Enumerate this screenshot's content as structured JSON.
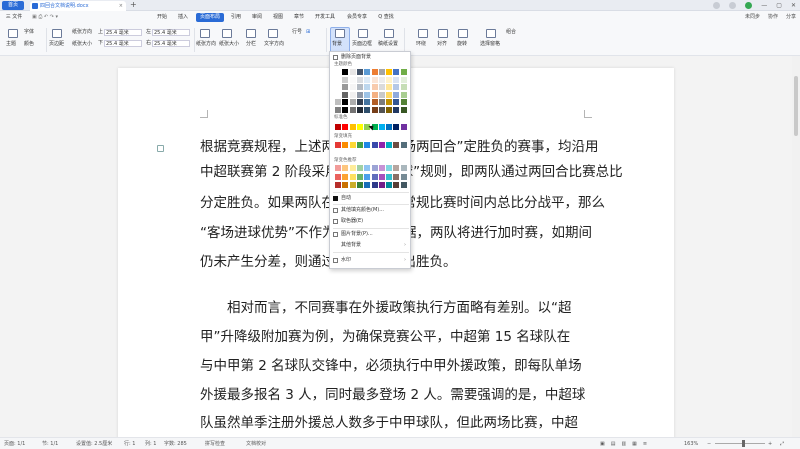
{
  "titlebar": {
    "home_tab": "首页",
    "doc_tab": "四回合文档说明.docx",
    "close": "×",
    "new_tab": "+"
  },
  "menu": {
    "file": "三 文件",
    "items": [
      "开始",
      "插入",
      "页面布局",
      "引用",
      "审阅",
      "视图",
      "章节",
      "开发工具",
      "会员专享"
    ],
    "active_index": 2,
    "search": "Q 查找",
    "right_items": [
      "未同步",
      "协作",
      "分享"
    ]
  },
  "ribbon": {
    "theme": "主题",
    "font_label": "字体",
    "color_label": "颜色",
    "margin": "页边距",
    "size": "纸张方向",
    "margin_top": "上",
    "margin_top_value": "25.4 毫米",
    "margin_bottom": "下",
    "margin_bottom_value": "25.4 毫米",
    "margin_left": "左",
    "margin_left_value": "25.4 毫米",
    "margin_right": "右",
    "margin_right_value": "25.4 毫米",
    "orientation": "纸张方向",
    "paper_size": "纸张大小",
    "columns": "分栏",
    "text_dir": "文字方向",
    "line_num": "行号",
    "page_bg": "背景",
    "page_border": "页面边框",
    "page_setup": "稿纸设置",
    "wrap": "环绕",
    "align": "对齐",
    "rotate": "旋转",
    "select_pane": "选择窗格",
    "group": "组合"
  },
  "document": {
    "lines": [
      "根据竞赛规程，上述两阶段以主客场两回合”定胜负的赛事，均沿用",
      "中超联赛第 2 阶段采用的”客场进球”规则，即两队通过两回合比赛总比",
      "分定胜负。如果两队在两回合比赛常规比赛时间内总比分战平，那么",
      "“客场进球优势”不作为胜负判定依据，两队将进行加时赛，如期间",
      "仍未产生分差，则通过点球大战决出胜负。",
      "相对而言，不同赛事在外援政策执行方面略有差别。以“超",
      "甲”升降级附加赛为例，为确保竞赛公平，中超第 15 名球队在",
      "与中甲第 2 名球队交锋中，必须执行中甲外援政策，即每队单场",
      "外援最多报名 3 人，同时最多登场 2 人。需要强调的是，中超球",
      "队虽然单季注册外援总人数多于中甲球队，但此两场比赛，中超"
    ]
  },
  "dropdown": {
    "delete_bg": "删除页面背景",
    "theme_colors": "主题颜色",
    "standard_colors": "标准色",
    "gradient_fill": "渐变填充",
    "gradient_style": "渐变色推荐",
    "auto": "自动",
    "other_fill": "其他填充颜色(M)...",
    "eyedropper": "取色器(E)",
    "image_bg": "图片背景(P)...",
    "other_bg": "其他背景",
    "watermark": "水印"
  },
  "palette": {
    "theme_top": [
      "#ffffff",
      "#000000",
      "#e7e6e6",
      "#44546a",
      "#5b9bd5",
      "#ed7d31",
      "#a5a5a5",
      "#ffc000",
      "#4472c4",
      "#70ad47"
    ],
    "standard": [
      "#c00000",
      "#ff0000",
      "#ffc000",
      "#ffff00",
      "#92d050",
      "#00b050",
      "#00b0f0",
      "#0070c0",
      "#002060",
      "#7030a0"
    ],
    "gradient": [
      "#e53935",
      "#fb8c00",
      "#fdd835",
      "#43a047",
      "#1e88e5",
      "#3949ab",
      "#8e24aa",
      "#00acc1",
      "#6d4c41",
      "#546e7a"
    ]
  },
  "statusbar": {
    "page": "页面: 1/1",
    "section": "节: 1/1",
    "position": "设置值: 2.5厘米",
    "row": "行: 1",
    "col": "列: 1",
    "words": "字数: 285",
    "spell": "拼写检查",
    "doc_check": "文档校对",
    "zoom": "163%"
  }
}
